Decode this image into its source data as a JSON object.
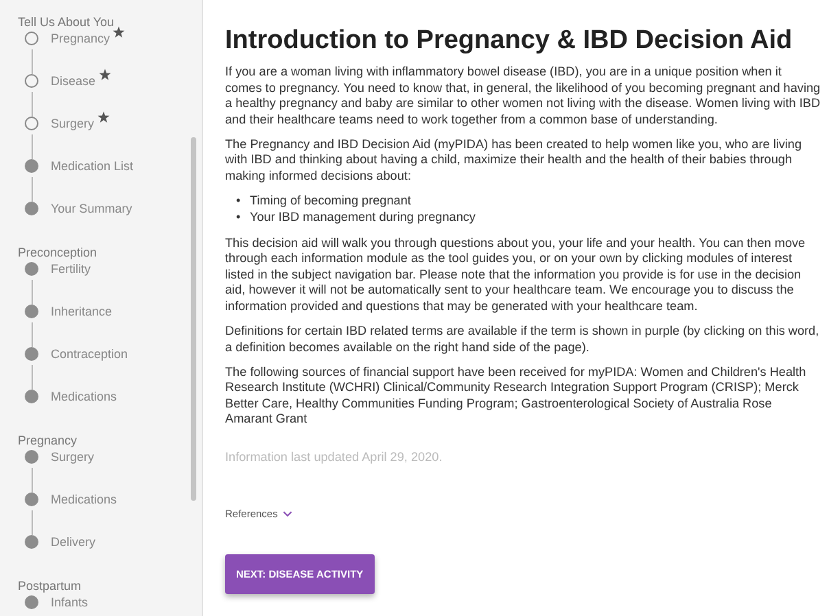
{
  "sidebar": {
    "sections": [
      {
        "heading": "Tell Us About You",
        "items": [
          {
            "label": "Pregnancy",
            "filled": false,
            "starred": true
          },
          {
            "label": "Disease",
            "filled": false,
            "starred": true
          },
          {
            "label": "Surgery",
            "filled": false,
            "starred": true
          },
          {
            "label": "Medication List",
            "filled": true,
            "starred": false
          },
          {
            "label": "Your Summary",
            "filled": true,
            "starred": false
          }
        ]
      },
      {
        "heading": "Preconception",
        "items": [
          {
            "label": "Fertility",
            "filled": true,
            "starred": false
          },
          {
            "label": "Inheritance",
            "filled": true,
            "starred": false
          },
          {
            "label": "Contraception",
            "filled": true,
            "starred": false
          },
          {
            "label": "Medications",
            "filled": true,
            "starred": false
          }
        ]
      },
      {
        "heading": "Pregnancy",
        "items": [
          {
            "label": "Surgery",
            "filled": true,
            "starred": false
          },
          {
            "label": "Medications",
            "filled": true,
            "starred": false
          },
          {
            "label": "Delivery",
            "filled": true,
            "starred": false
          }
        ]
      },
      {
        "heading": "Postpartum",
        "items": [
          {
            "label": "Infants",
            "filled": true,
            "starred": false
          }
        ]
      }
    ]
  },
  "main": {
    "title": "Introduction to Pregnancy & IBD Decision Aid",
    "paragraphs": [
      "If you are a woman living with inflammatory bowel disease (IBD), you are in a unique position when it comes to pregnancy. You need to know that, in general, the likelihood of you becoming pregnant and having a healthy pregnancy and baby are similar to other women not living with the disease. Women living with IBD and their healthcare teams need to work together from a common base of understanding.",
      "The Pregnancy and IBD Decision Aid (myPIDA) has been created to help women like you, who are living with IBD and thinking about having a child, maximize their health and the health of their babies through making informed decisions about:"
    ],
    "bullets": [
      {
        "marker": "•",
        "text": "Timing of becoming pregnant"
      },
      {
        "marker": "•",
        "text": "Your IBD management during pregnancy"
      }
    ],
    "paragraphs_after": [
      "This decision aid will walk you through questions about you, your life and your health. You can then move through each information module as the tool guides you, or on your own by clicking modules of interest listed in the subject navigation bar. Please note that the information you provide is for use in the decision aid, however it will not be automatically sent to your healthcare team. We encourage you to discuss the information provided and questions that may be generated with your healthcare team.",
      "Definitions for certain IBD related terms are available if the term is shown in purple (by clicking on this word, a definition becomes available on the right hand side of the page).",
      "The following sources of financial support have been received for myPIDA: Women and Children's Health Research Institute (WCHRI) Clinical/Community Research Integration Support Program (CRISP); Merck Better Care, Healthy Communities Funding Program; Gastroenterological Society of Australia Rose Amarant Grant"
    ],
    "updated": "Information last updated April 29, 2020.",
    "references": {
      "label": "References",
      "expanded": false
    },
    "next_button": "NEXT: DISEASE ACTIVITY"
  }
}
